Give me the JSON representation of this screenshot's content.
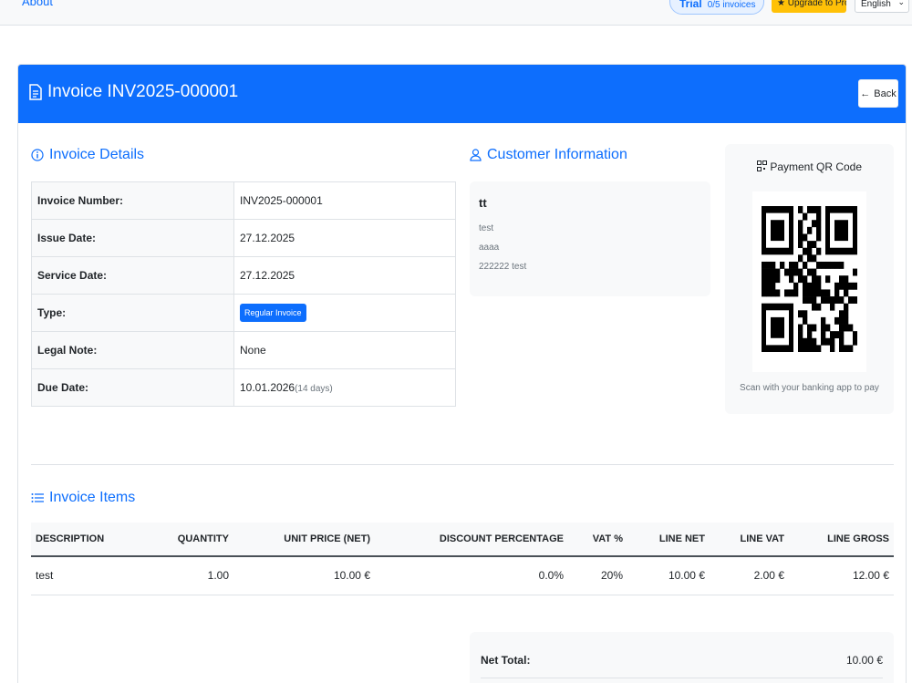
{
  "nav": {
    "about_label": "About",
    "plan_label": "Trial",
    "plan_count": "0/5 invoices",
    "upgrade_label": "Upgrade to Pro",
    "language": "English"
  },
  "header": {
    "title": "Invoice INV2025-000001",
    "back_label": "Back"
  },
  "details": {
    "section_title": "Invoice Details",
    "rows": [
      {
        "label": "Invoice Number:",
        "value": "INV2025-000001"
      },
      {
        "label": "Issue Date:",
        "value": "27.12.2025"
      },
      {
        "label": "Service Date:",
        "value": "27.12.2025"
      },
      {
        "label": "Type:",
        "value": "Regular Invoice"
      },
      {
        "label": "Legal Note:",
        "value": "None"
      },
      {
        "label": "Due Date:",
        "value": "10.01.2026",
        "note": "(14 days)"
      }
    ]
  },
  "customer": {
    "section_title": "Customer Information",
    "name": "tt",
    "lines": [
      "test",
      "aaaa",
      "222222 test"
    ]
  },
  "qr": {
    "title": "Payment QR Code",
    "caption": "Scan with your banking app to pay"
  },
  "items": {
    "section_title": "Invoice Items",
    "columns": [
      "Description",
      "Quantity",
      "Unit Price (Net)",
      "Discount Percentage",
      "VAT %",
      "Line Net",
      "Line VAT",
      "Line Gross"
    ],
    "rows": [
      [
        "test",
        "1.00",
        "10.00 €",
        "0.0%",
        "20%",
        "10.00 €",
        "2.00 €",
        "12.00 €"
      ]
    ]
  },
  "totals": {
    "net_total_label": "Net Total:",
    "net_total_value": "10.00 €"
  },
  "colors": {
    "primary": "#0d6efd",
    "warning": "#ffc107",
    "panel": "#f8f9fa"
  }
}
